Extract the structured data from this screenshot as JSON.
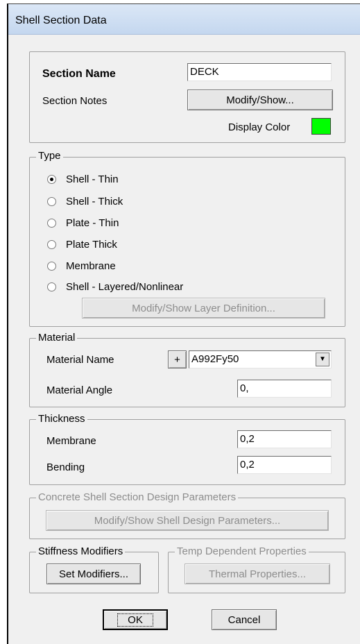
{
  "window": {
    "title": "Shell Section Data"
  },
  "section": {
    "name_label": "Section Name",
    "name_value": "DECK",
    "notes_label": "Section Notes",
    "notes_button": "Modify/Show...",
    "color_label": "Display Color",
    "color_value": "#00ff00"
  },
  "type": {
    "legend": "Type",
    "options": [
      {
        "label": "Shell - Thin",
        "checked": true
      },
      {
        "label": "Shell - Thick",
        "checked": false
      },
      {
        "label": "Plate - Thin",
        "checked": false
      },
      {
        "label": "Plate Thick",
        "checked": false
      },
      {
        "label": "Membrane",
        "checked": false
      },
      {
        "label": "Shell - Layered/Nonlinear",
        "checked": false
      }
    ],
    "layer_button": "Modify/Show Layer Definition..."
  },
  "material": {
    "legend": "Material",
    "name_label": "Material Name",
    "add_button": "+",
    "name_value": "A992Fy50",
    "angle_label": "Material Angle",
    "angle_value": "0,"
  },
  "thickness": {
    "legend": "Thickness",
    "membrane_label": "Membrane",
    "membrane_value": "0,2",
    "bending_label": "Bending",
    "bending_value": "0,2"
  },
  "concrete": {
    "legend": "Concrete Shell Section Design Parameters",
    "button": "Modify/Show Shell Design Parameters..."
  },
  "stiffness": {
    "legend": "Stiffness Modifiers",
    "button": "Set Modifiers..."
  },
  "temp": {
    "legend": "Temp Dependent Properties",
    "button": "Thermal Properties..."
  },
  "footer": {
    "ok_button": "OK",
    "cancel_button": "Cancel"
  }
}
